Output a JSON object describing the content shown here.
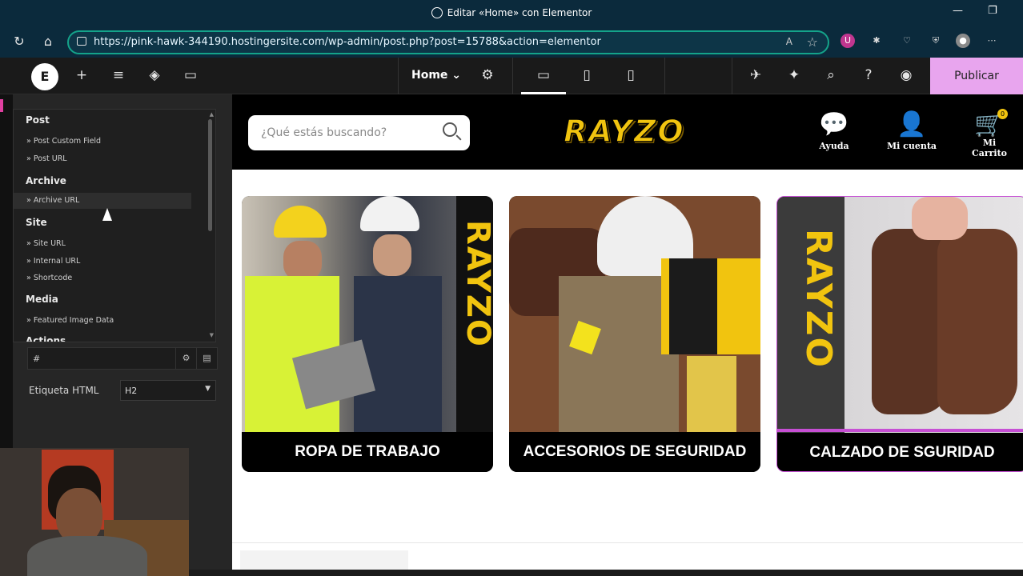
{
  "window": {
    "title": "Editar «Home» con Elementor"
  },
  "browser": {
    "url": "https://pink-hawk-344190.hostingersite.com/wp-admin/post.php?post=15788&action=elementor",
    "reader_label": "A"
  },
  "editor": {
    "page_name": "Home",
    "publish_label": "Publicar"
  },
  "dynamic_tags": {
    "groups": [
      {
        "label": "Post",
        "items": [
          "Post Custom Field",
          "Post URL"
        ]
      },
      {
        "label": "Archive",
        "items": [
          "Archive URL"
        ]
      },
      {
        "label": "Site",
        "items": [
          "Site URL",
          "Internal URL",
          "Shortcode"
        ]
      },
      {
        "label": "Media",
        "items": [
          "Featured Image Data"
        ]
      },
      {
        "label": "Actions",
        "items": []
      }
    ]
  },
  "link_field": {
    "value": "#"
  },
  "html_tag": {
    "label": "Etiqueta HTML",
    "value": "H2"
  },
  "site": {
    "search_placeholder": "¿Qué estás buscando?",
    "brand": "RAYZO",
    "header_links": [
      "Ayuda",
      "Mi cuenta",
      "Mi Carrito"
    ],
    "cart_count": "0",
    "categories": [
      {
        "title": "ROPA DE TRABAJO"
      },
      {
        "title": "ACCESORIOS DE SEGURIDAD"
      },
      {
        "title": "CALZADO DE SGURIDAD"
      }
    ]
  },
  "colors": {
    "brand_yellow": "#f1c40f",
    "publish_bg": "#e8a5ee",
    "url_border": "#14a38a"
  }
}
